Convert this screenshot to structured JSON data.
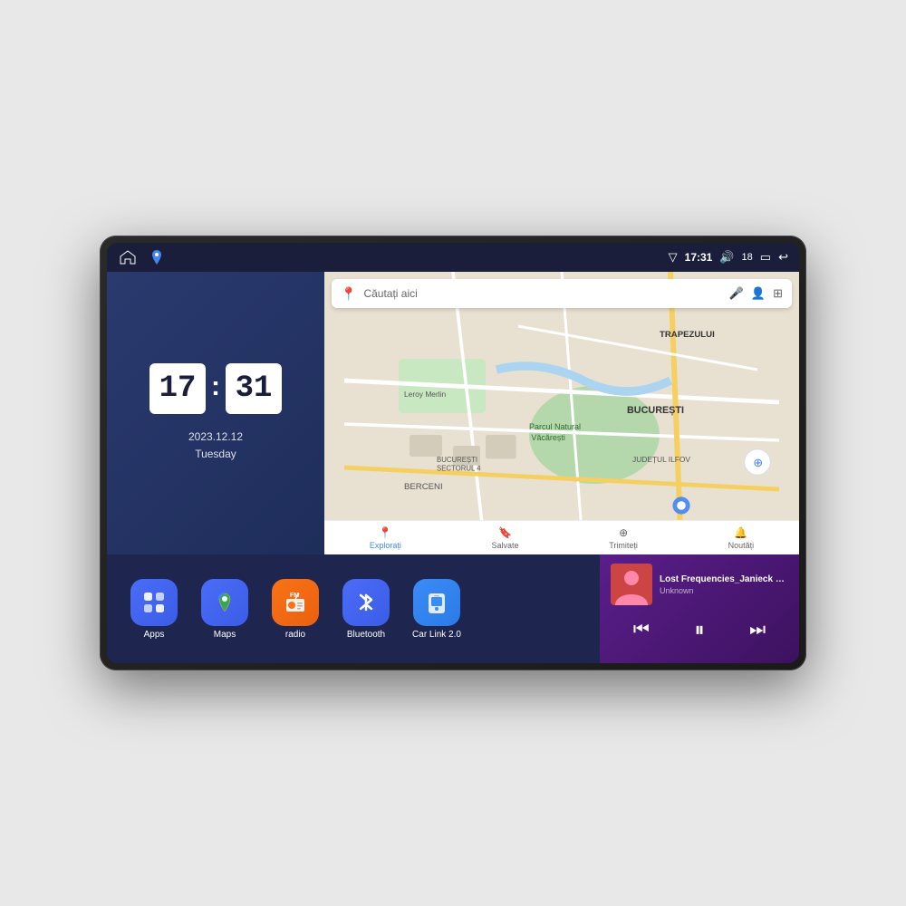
{
  "device": {
    "screen_bg": "#1a1e3a"
  },
  "status_bar": {
    "time": "17:31",
    "signal_icon": "▽",
    "volume_icon": "🔊",
    "battery_value": "18",
    "battery_icon": "🔋",
    "back_icon": "↩"
  },
  "clock": {
    "hour": "17",
    "minute": "31",
    "date": "2023.12.12",
    "day": "Tuesday"
  },
  "map": {
    "search_placeholder": "Căutați aici",
    "nav_items": [
      {
        "label": "Explorați",
        "icon": "📍",
        "active": true
      },
      {
        "label": "Salvate",
        "icon": "🔖",
        "active": false
      },
      {
        "label": "Trimiteți",
        "icon": "⊕",
        "active": false
      },
      {
        "label": "Noutăți",
        "icon": "🔔",
        "active": false
      }
    ],
    "location_labels": [
      "TRAPEZULUI",
      "BUCUREȘTI",
      "JUDEȚUL ILFOV",
      "BERCENI",
      "Leroy Merlin",
      "Parcul Natural Văcărești",
      "BUCUREȘTI SECTORUL 4"
    ]
  },
  "apps": [
    {
      "id": "apps",
      "label": "Apps",
      "icon": "⊞",
      "bg_class": "app-icon-apps"
    },
    {
      "id": "maps",
      "label": "Maps",
      "icon": "🗺",
      "bg_class": "app-icon-maps"
    },
    {
      "id": "radio",
      "label": "radio",
      "icon": "📻",
      "bg_class": "app-icon-radio"
    },
    {
      "id": "bluetooth",
      "label": "Bluetooth",
      "icon": "Ƀ",
      "bg_class": "app-icon-bluetooth"
    },
    {
      "id": "carlink",
      "label": "Car Link 2.0",
      "icon": "📱",
      "bg_class": "app-icon-carlink"
    }
  ],
  "music": {
    "title": "Lost Frequencies_Janieck Devy-...",
    "artist": "Unknown",
    "controls": {
      "prev": "⏮",
      "play": "⏸",
      "next": "⏭"
    }
  }
}
